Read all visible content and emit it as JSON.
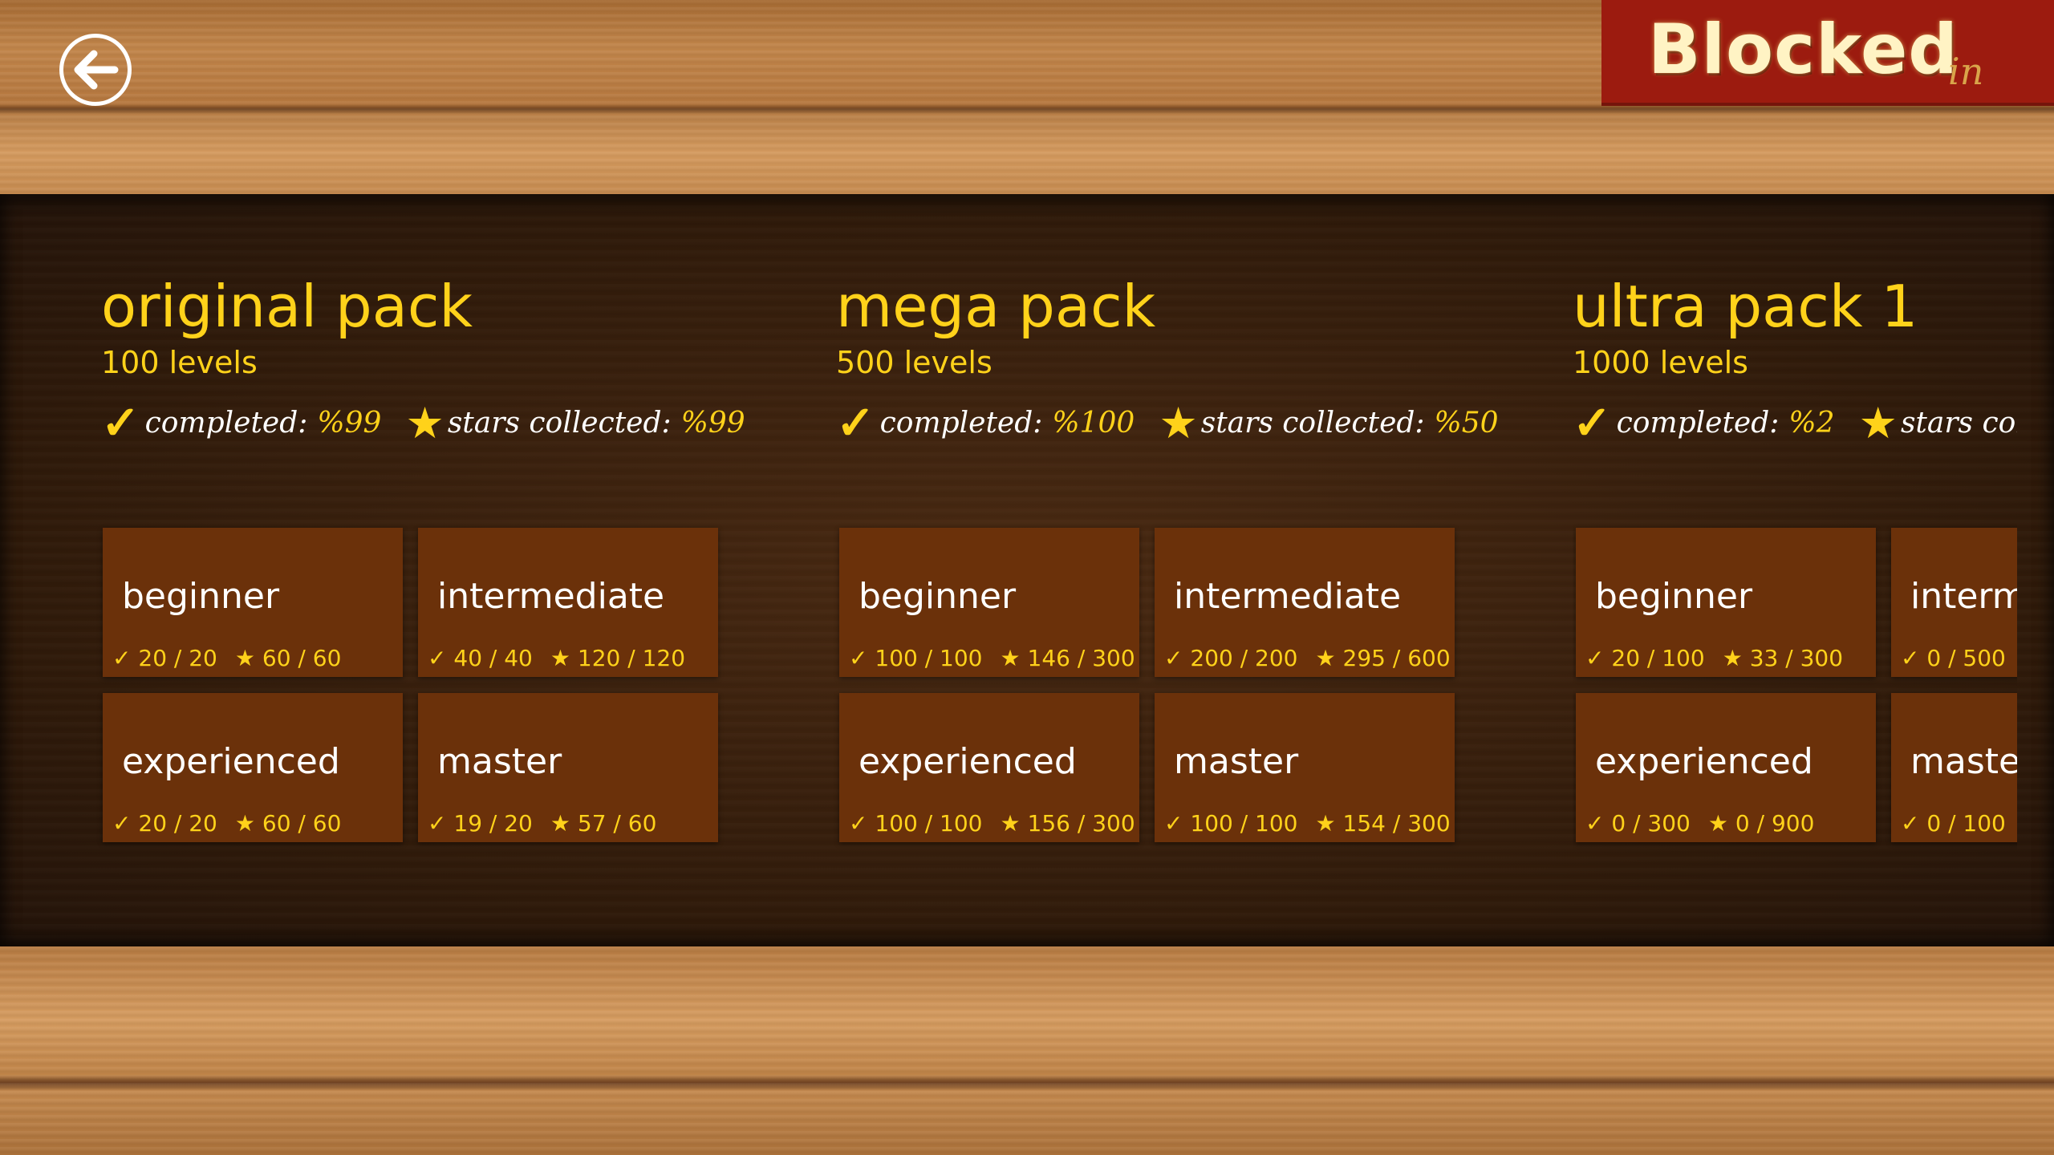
{
  "header": {
    "back_label": "back",
    "logo_main": "Blocked",
    "logo_sub": "in"
  },
  "labels": {
    "completed": "completed:",
    "stars_collected": "stars collected:"
  },
  "packs": [
    {
      "title": "original pack",
      "levels": "100 levels",
      "completed": "%99",
      "stars": "%99",
      "tiles": [
        {
          "name": "beginner",
          "done": "20 / 20",
          "stars": "60 / 60"
        },
        {
          "name": "intermediate",
          "done": "40 / 40",
          "stars": "120 / 120"
        },
        {
          "name": "experienced",
          "done": "20 / 20",
          "stars": "60 / 60"
        },
        {
          "name": "master",
          "done": "19 / 20",
          "stars": "57 / 60"
        }
      ]
    },
    {
      "title": "mega pack",
      "levels": "500 levels",
      "completed": "%100",
      "stars": "%50",
      "tiles": [
        {
          "name": "beginner",
          "done": "100 / 100",
          "stars": "146 / 300"
        },
        {
          "name": "intermediate",
          "done": "200 / 200",
          "stars": "295 / 600"
        },
        {
          "name": "experienced",
          "done": "100 / 100",
          "stars": "156 / 300"
        },
        {
          "name": "master",
          "done": "100 / 100",
          "stars": "154 / 300"
        }
      ]
    },
    {
      "title": "ultra pack 1",
      "levels": "1000 levels",
      "completed": "%2",
      "stars": "",
      "tiles": [
        {
          "name": "beginner",
          "done": "20 / 100",
          "stars": "33 / 300"
        },
        {
          "name": "interm",
          "done": "0 / 500",
          "stars": ""
        },
        {
          "name": "experienced",
          "done": "0 / 300",
          "stars": "0 / 900"
        },
        {
          "name": "master",
          "done": "0 / 100",
          "stars": ""
        }
      ]
    }
  ],
  "colors": {
    "accent": "#ffd21a",
    "tile": "#6b310a",
    "logo_bg": "#9c1b0f"
  }
}
